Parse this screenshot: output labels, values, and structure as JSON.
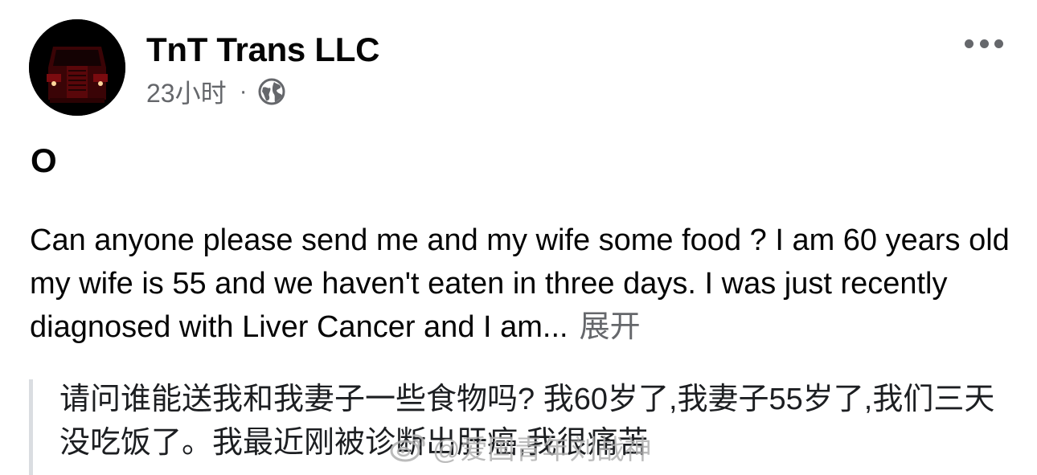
{
  "post": {
    "author": "TnT Trans LLC",
    "time": "23小时",
    "separator": "·",
    "title": "O",
    "body": "Can anyone please send me and my wife some food ? I am 60 years old my wife is 55 and we haven't eaten in three days. I was just recently diagnosed with Liver Cancer and I am...",
    "expand_label": "展开",
    "translation": "请问谁能送我和我妻子一些食物吗? 我60岁了,我妻子55岁了,我们三天没吃饭了。我最近刚被诊断出肝癌,我很痛苦",
    "translation_cut": "$hightrans1134"
  },
  "watermark": "@爱国青年刘战神",
  "icons": {
    "avatar": "red-truck-avatar",
    "audience": "globe-icon",
    "more": "more-options-icon",
    "watermark": "weibo-logo-icon"
  },
  "colors": {
    "text": "#050505",
    "secondary": "#65676b",
    "quote_bar": "#dadde1"
  }
}
